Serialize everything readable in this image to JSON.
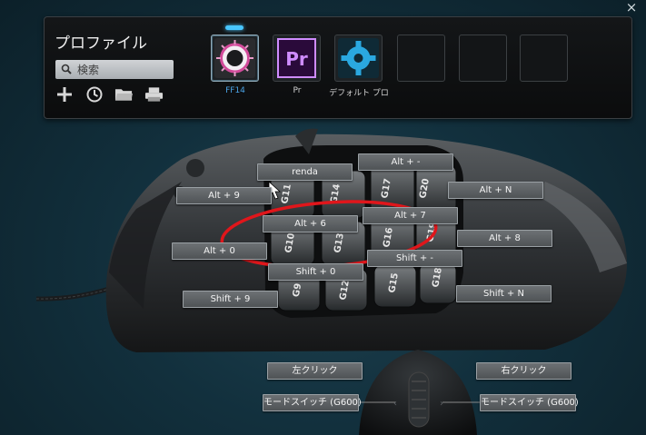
{
  "window": {
    "close_label": "×"
  },
  "profile": {
    "title": "プロファイル",
    "search_placeholder": "検索",
    "tools": [
      "add-icon",
      "clock-icon",
      "folder-icon",
      "printer-icon"
    ],
    "slots": [
      {
        "label": "FF14",
        "icon": "ff14-app-icon",
        "active": true
      },
      {
        "label": "Pr",
        "icon": "premiere-app-icon",
        "active": false
      },
      {
        "label": "デフォルト プロ",
        "icon": "gear-app-icon",
        "active": false
      },
      {
        "label": "",
        "icon": "",
        "active": false
      },
      {
        "label": "",
        "icon": "",
        "active": false
      },
      {
        "label": "",
        "icon": "",
        "active": false
      }
    ],
    "premiere_text": "Pr"
  },
  "mouse": {
    "keys": [
      {
        "id": "g9",
        "label": "G9"
      },
      {
        "id": "g10",
        "label": "G10"
      },
      {
        "id": "g11",
        "label": "G11"
      },
      {
        "id": "g12",
        "label": "G12"
      },
      {
        "id": "g13",
        "label": "G13"
      },
      {
        "id": "g14",
        "label": "G14"
      },
      {
        "id": "g15",
        "label": "G15"
      },
      {
        "id": "g16",
        "label": "G16"
      },
      {
        "id": "g17",
        "label": "G17"
      },
      {
        "id": "g18",
        "label": "G18"
      },
      {
        "id": "g19",
        "label": "G19"
      },
      {
        "id": "g20",
        "label": "G20"
      }
    ],
    "assignments": [
      {
        "name": "renda",
        "text": "renda"
      },
      {
        "name": "alt-minus",
        "text": "Alt + -"
      },
      {
        "name": "alt-9",
        "text": "Alt + 9"
      },
      {
        "name": "alt-n",
        "text": "Alt + N"
      },
      {
        "name": "alt-7",
        "text": "Alt + 7"
      },
      {
        "name": "alt-6",
        "text": "Alt + 6"
      },
      {
        "name": "alt-8",
        "text": "Alt + 8"
      },
      {
        "name": "alt-0",
        "text": "Alt + 0"
      },
      {
        "name": "shift-minus",
        "text": "Shift + -"
      },
      {
        "name": "shift-0",
        "text": "Shift + 0"
      },
      {
        "name": "shift-9",
        "text": "Shift + 9"
      },
      {
        "name": "shift-n",
        "text": "Shift + N"
      },
      {
        "name": "left-click",
        "text": "左クリック"
      },
      {
        "name": "right-click",
        "text": "右クリック"
      },
      {
        "name": "mode-switch-left",
        "text": "モードスイッチ (G600)"
      },
      {
        "name": "mode-switch-right",
        "text": "モードスイッチ (G600)"
      }
    ]
  }
}
